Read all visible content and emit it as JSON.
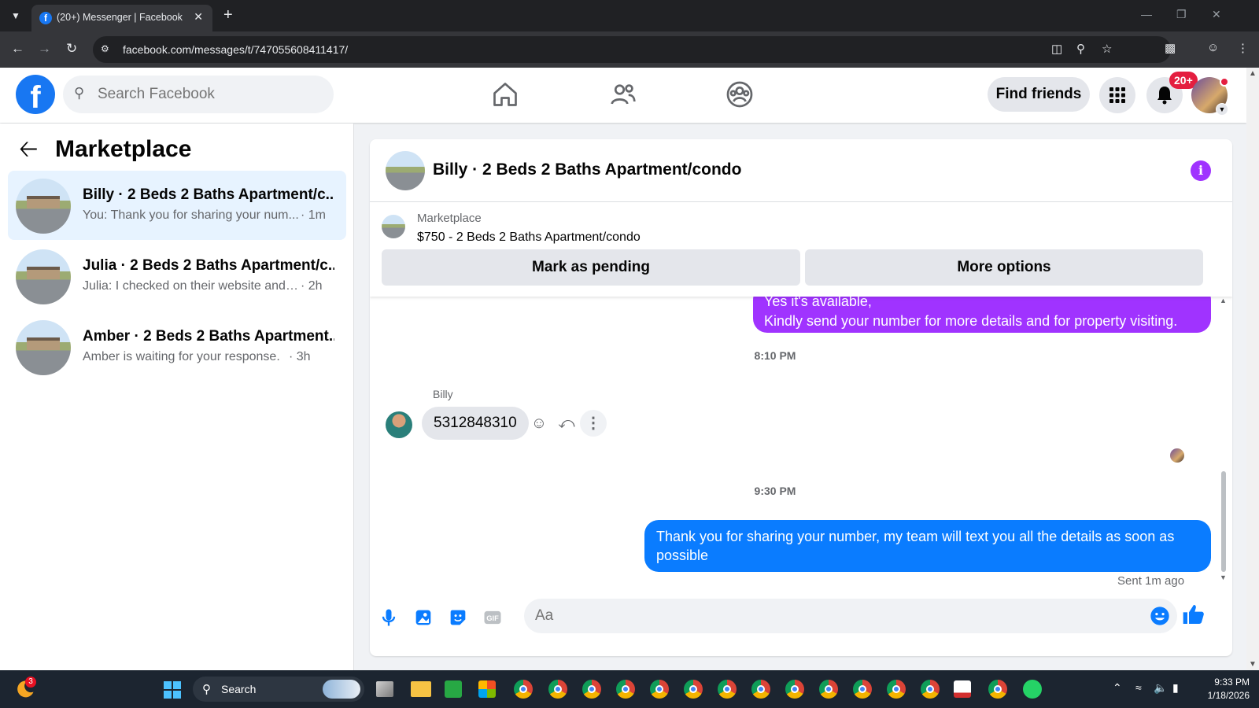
{
  "browser": {
    "tab_title": "(20+) Messenger | Facebook",
    "url": "facebook.com/messages/t/747055608411417/"
  },
  "header": {
    "search_placeholder": "Search Facebook",
    "find_friends_label": "Find friends",
    "notification_badge": "20+"
  },
  "sidebar": {
    "title": "Marketplace",
    "threads": [
      {
        "name": "Billy · 2 Beds 2 Baths Apartment/c...",
        "preview": "You: Thank you for sharing your num...",
        "time": "· 1m",
        "active": true
      },
      {
        "name": "Julia · 2 Beds 2 Baths Apartment/c...",
        "preview": "Julia: I checked on their website and it...",
        "time": "· 2h",
        "active": false
      },
      {
        "name": "Amber · 2 Beds 2 Baths Apartment...",
        "preview": "Amber is waiting for your response.",
        "time": "· 3h",
        "active": false
      }
    ]
  },
  "chat": {
    "title": "Billy · 2 Beds 2 Baths Apartment/condo",
    "listing": {
      "source": "Marketplace",
      "title": "$750 - 2 Beds 2 Baths Apartment/condo",
      "mark_pending_label": "Mark as pending",
      "more_options_label": "More options"
    },
    "messages": {
      "outgoing_1_line1": "Yes it's available,",
      "outgoing_1_line2": "Kindly send your number for more details and for property visiting.",
      "timestamp_1": "8:10 PM",
      "sender_name": "Billy",
      "incoming_1": "5312848310",
      "timestamp_2": "9:30 PM",
      "outgoing_2": "Thank you for  sharing your number, my team will text you all the details as soon as possible",
      "sent_status": "Sent 1m ago"
    },
    "composer_placeholder": "Aa"
  },
  "taskbar": {
    "search_label": "Search",
    "weather_badge": "3",
    "time": "9:33 PM",
    "date": "1/18/2026"
  },
  "colors": {
    "fb_blue": "#1877f2",
    "outgoing_blue": "#0a7cff",
    "outgoing_purple": "#a033ff",
    "notification_red": "#e41e3f"
  }
}
